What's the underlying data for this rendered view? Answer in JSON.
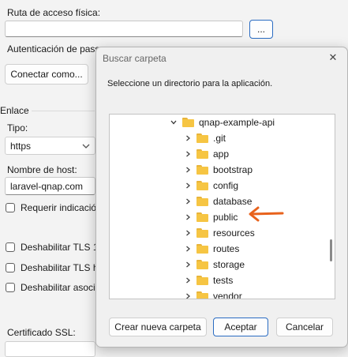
{
  "main": {
    "path_label": "Ruta de acceso física:",
    "browse_label": "...",
    "auth_label": "Autenticación de pass",
    "connect_label": "Conectar como...",
    "binding_label": "Enlace",
    "type_label": "Tipo:",
    "type_value": "https",
    "host_label": "Nombre de host:",
    "host_value": "laravel-qnap.com",
    "require_label": "Requerir indicació",
    "tls1_label": "Deshabilitar TLS 1.",
    "tls_he_label": "Deshabilitar TLS he",
    "assoc_label": "Deshabilitar asocia",
    "cert_label": "Certificado SSL:"
  },
  "dialog": {
    "title": "Buscar carpeta",
    "close_glyph": "✕",
    "instruction": "Seleccione un directorio para la aplicación.",
    "root_folder": "qnap-example-api",
    "children": [
      ".git",
      "app",
      "bootstrap",
      "config",
      "database",
      "public",
      "resources",
      "routes",
      "storage",
      "tests",
      "vendor"
    ],
    "new_folder_label": "Crear nueva carpeta",
    "ok_label": "Aceptar",
    "cancel_label": "Cancelar"
  },
  "colors": {
    "annotation_arrow": "#e8621c",
    "folder_yellow": "#f6c543"
  }
}
